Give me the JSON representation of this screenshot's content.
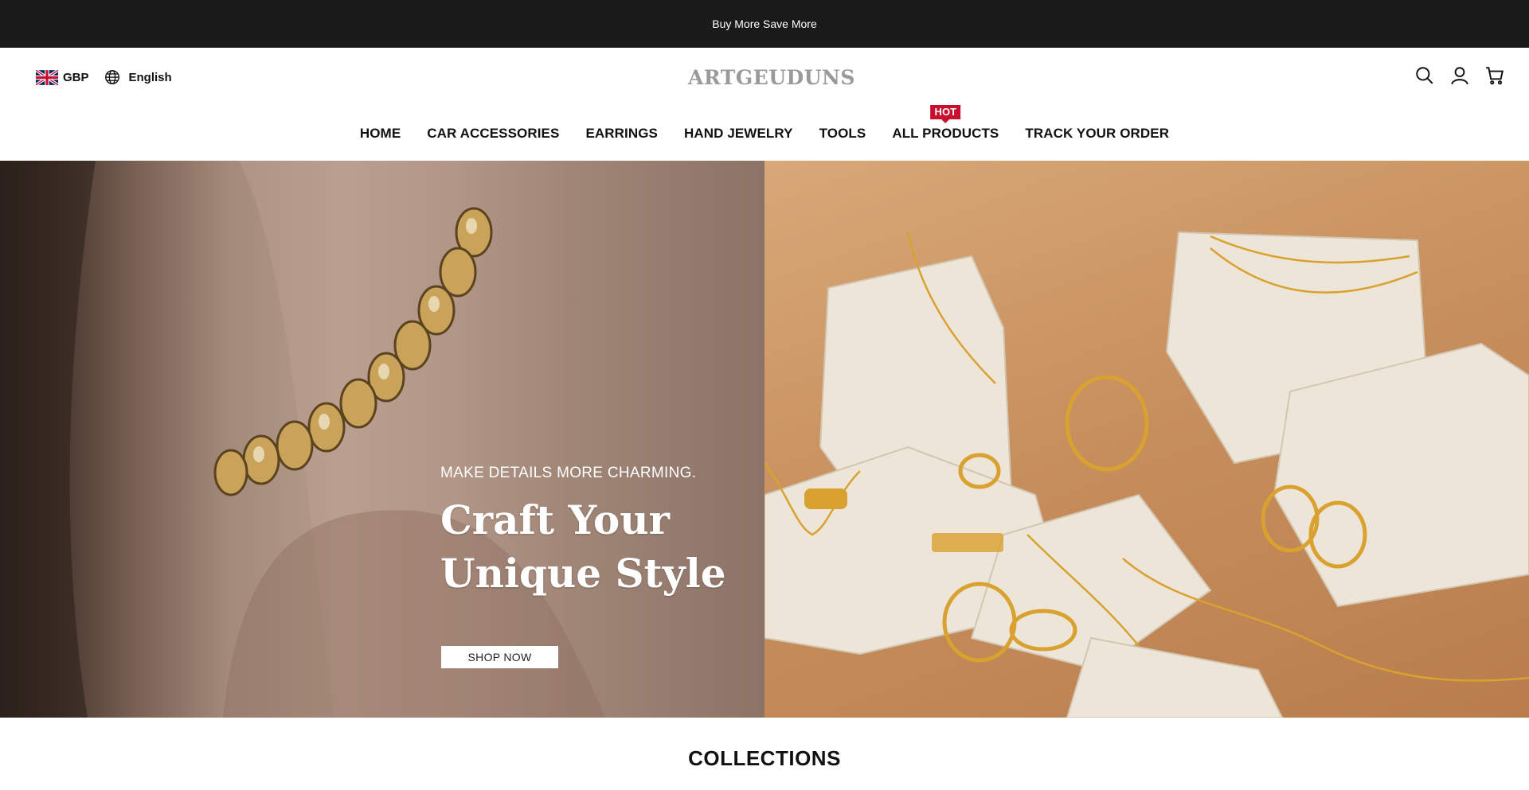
{
  "announcement": {
    "text": "Buy More Save More"
  },
  "header": {
    "currency": "GBP",
    "language": "English",
    "logo_text": "ARTGEUDUNS"
  },
  "nav": {
    "items": [
      {
        "label": "HOME"
      },
      {
        "label": "CAR ACCESSORIES"
      },
      {
        "label": "EARRINGS"
      },
      {
        "label": "HAND JEWELRY"
      },
      {
        "label": "TOOLS"
      },
      {
        "label": "ALL PRODUCTS",
        "badge": "HOT"
      },
      {
        "label": "TRACK YOUR ORDER"
      }
    ]
  },
  "hero": {
    "subtitle": "MAKE DETAILS MORE CHARMING.",
    "title_line1": "Craft Your",
    "title_line2": "Unique Style",
    "cta": "SHOP NOW"
  },
  "sections": {
    "collections_title": "COLLECTIONS"
  },
  "colors": {
    "announcement_bg": "#1a1a1b",
    "hot_badge": "#c8102e",
    "logo": "#9a9a9a"
  },
  "icons": [
    "uk-flag-icon",
    "globe-icon",
    "search-icon",
    "account-icon",
    "cart-icon"
  ]
}
